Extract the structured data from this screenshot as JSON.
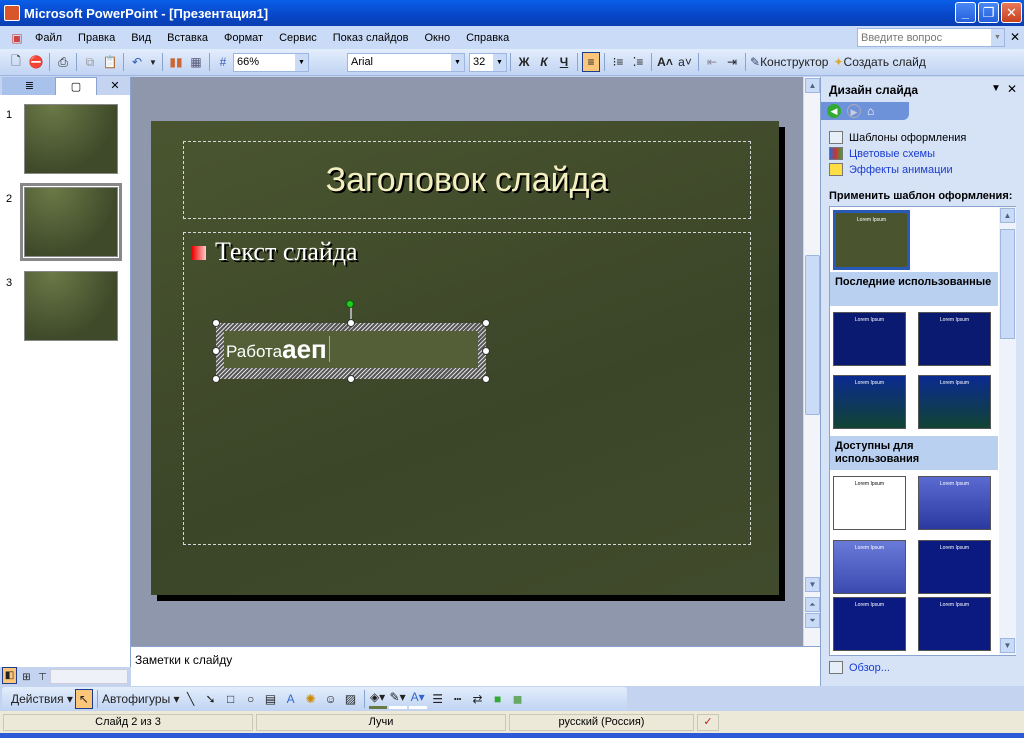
{
  "window": {
    "title": "Microsoft PowerPoint - [Презентация1]"
  },
  "menu": [
    "Файл",
    "Правка",
    "Вид",
    "Вставка",
    "Формат",
    "Сервис",
    "Показ слайдов",
    "Окно",
    "Справка"
  ],
  "help": {
    "placeholder": "Введите вопрос"
  },
  "toolbar": {
    "zoom": "66%",
    "font": "Arial",
    "size": "32",
    "bold": "Ж",
    "italic": "К",
    "underline": "Ч",
    "designer": "Конструктор",
    "new_slide": "Создать слайд"
  },
  "slides": {
    "numbers": [
      "1",
      "2",
      "3"
    ],
    "selected": 2
  },
  "slide": {
    "title": "Заголовок слайда",
    "bullet": "Текст слайда",
    "textbox_small": "Работа",
    "textbox_large": "аеп"
  },
  "notes": {
    "placeholder": "Заметки к слайду"
  },
  "taskpane": {
    "title": "Дизайн слайда",
    "links": [
      "Шаблоны оформления",
      "Цветовые схемы",
      "Эффекты анимации"
    ],
    "apply_label": "Применить шаблон оформления:",
    "recent": "Последние использованные",
    "available": "Доступны для использования",
    "template_title": "Lorem Ipsum",
    "browse": "Обзор..."
  },
  "drawing": {
    "actions": "Действия",
    "autoshapes": "Автофигуры"
  },
  "status": {
    "slide": "Слайд 2 из 3",
    "design": "Лучи",
    "language": "русский (Россия)"
  }
}
